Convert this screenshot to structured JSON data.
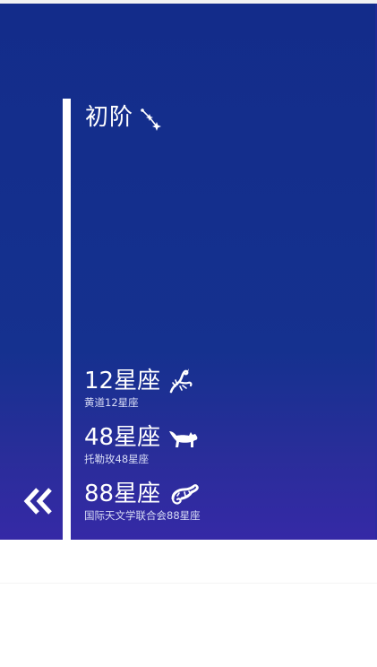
{
  "level": {
    "title": "初阶",
    "icon": "constellation-stars-icon"
  },
  "items": [
    {
      "title": "12星座",
      "subtitle": "黄道12星座",
      "icon": "scorpion-icon"
    },
    {
      "title": "48星座",
      "subtitle": "托勒玫48星座",
      "icon": "wolf-icon"
    },
    {
      "title": "88星座",
      "subtitle": "国际天文学联合会88星座",
      "icon": "chameleon-icon"
    }
  ],
  "navigation": {
    "back_icon": "double-chevron-left-icon"
  },
  "colors": {
    "panel_top": "#132c8a",
    "panel_bottom": "#3529a6",
    "text": "#ffffff"
  }
}
